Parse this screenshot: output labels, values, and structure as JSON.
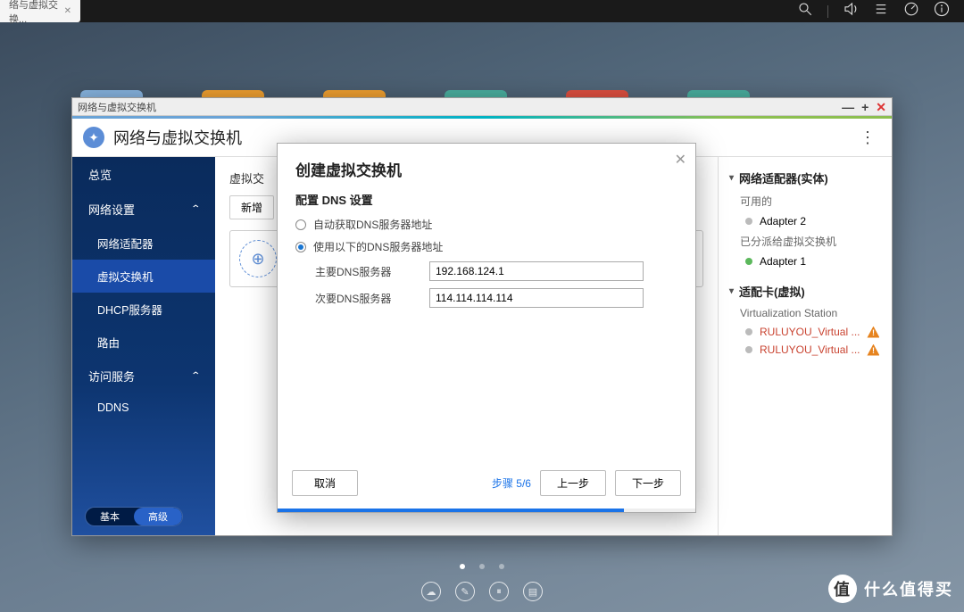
{
  "topbar": {
    "tab_label": "络与虚拟交换..."
  },
  "window": {
    "title": "网络与虚拟交换机"
  },
  "app": {
    "title": "网络与虚拟交换机"
  },
  "sidebar": {
    "overview": "总览",
    "network_settings": "网络设置",
    "adapter": "网络适配器",
    "vswitch": "虚拟交换机",
    "dhcp": "DHCP服务器",
    "route": "路由",
    "access": "访问服务",
    "ddns": "DDNS",
    "toggle_basic": "基本",
    "toggle_adv": "高级"
  },
  "center": {
    "heading": "虚拟交",
    "add_btn": "新增"
  },
  "rightpanel": {
    "head1": "网络适配器(实体)",
    "available": "可用的",
    "adapter2": "Adapter 2",
    "assigned": "已分派给虚拟交换机",
    "adapter1": "Adapter 1",
    "head2": "适配卡(虚拟)",
    "vstation": "Virtualization Station",
    "vitem1": "RULUYOU_Virtual ...",
    "vitem2": "RULUYOU_Virtual ..."
  },
  "modal": {
    "title": "创建虚拟交换机",
    "subtitle": "配置 DNS 设置",
    "opt_auto": "自动获取DNS服务器地址",
    "opt_manual": "使用以下的DNS服务器地址",
    "primary_label": "主要DNS服务器",
    "secondary_label": "次要DNS服务器",
    "primary_value": "192.168.124.1",
    "secondary_value": "114.114.114.114",
    "cancel": "取消",
    "step": "步骤 5/6",
    "prev": "上一步",
    "next": "下一步"
  },
  "watermark": "什么值得买"
}
